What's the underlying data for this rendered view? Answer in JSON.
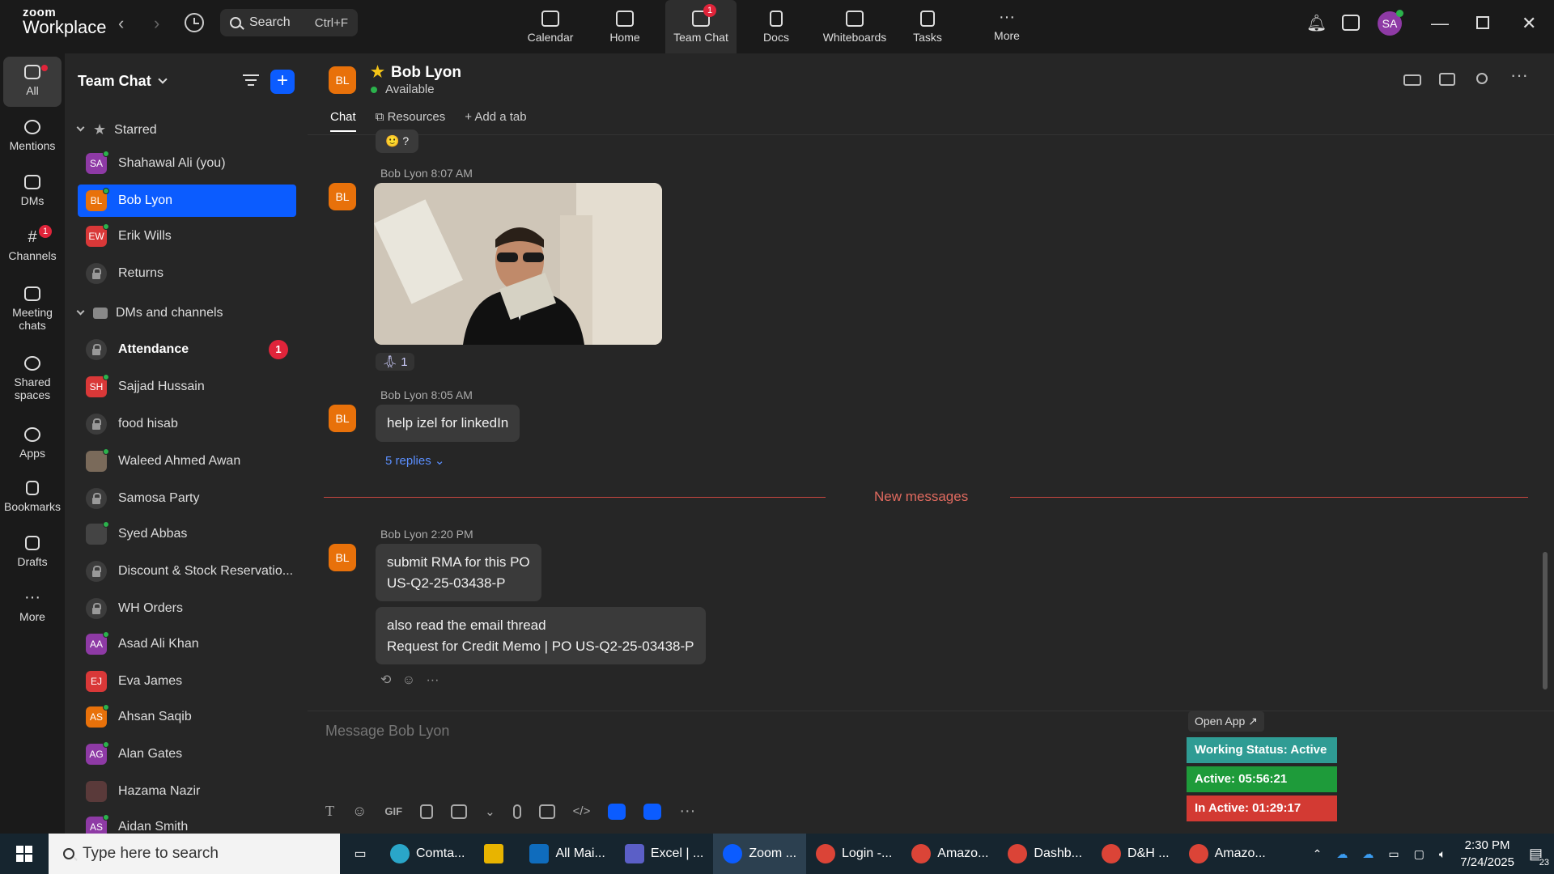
{
  "app": {
    "brand_top": "zoom",
    "brand_bottom": "Workplace"
  },
  "topbar": {
    "search_label": "Search",
    "search_shortcut": "Ctrl+F",
    "nav": [
      {
        "label": "Calendar"
      },
      {
        "label": "Home"
      },
      {
        "label": "Team Chat",
        "badge": "1"
      },
      {
        "label": "Docs"
      },
      {
        "label": "Whiteboards"
      },
      {
        "label": "Tasks"
      },
      {
        "label": "More"
      }
    ],
    "user_initials": "SA"
  },
  "rail": [
    {
      "label": "All"
    },
    {
      "label": "Mentions"
    },
    {
      "label": "DMs"
    },
    {
      "label": "Channels",
      "badge": "1"
    },
    {
      "label": "Meeting chats"
    },
    {
      "label": "Shared spaces"
    },
    {
      "label": "Apps"
    },
    {
      "label": "Bookmarks"
    },
    {
      "label": "Drafts"
    },
    {
      "label": "More"
    }
  ],
  "sidebar": {
    "title": "Team Chat",
    "section_starred": "Starred",
    "section_dms": "DMs and channels",
    "starred": [
      {
        "initials": "SA",
        "name": "Shahawal Ali (you)",
        "color": "#8e3aa5"
      },
      {
        "initials": "BL",
        "name": "Bob Lyon",
        "color": "#e8710a"
      },
      {
        "initials": "EW",
        "name": "Erik Wills",
        "color": "#d93838"
      },
      {
        "initials": "",
        "name": "Returns",
        "color": ""
      }
    ],
    "channels": [
      {
        "initials": "",
        "name": "Attendance",
        "badge": "1"
      },
      {
        "initials": "SH",
        "name": "Sajjad Hussain",
        "color": "#d93838"
      },
      {
        "initials": "",
        "name": "food hisab"
      },
      {
        "initials": "",
        "name": "Waleed Ahmed Awan",
        "color": "#7a6a5a"
      },
      {
        "initials": "",
        "name": "Samosa Party"
      },
      {
        "initials": "",
        "name": "Syed Abbas",
        "color": "#444"
      },
      {
        "initials": "",
        "name": "Discount & Stock Reservatio..."
      },
      {
        "initials": "",
        "name": "WH Orders"
      },
      {
        "initials": "AA",
        "name": "Asad Ali Khan",
        "color": "#8e3aa5"
      },
      {
        "initials": "EJ",
        "name": "Eva James",
        "color": "#d93838"
      },
      {
        "initials": "AS",
        "name": "Ahsan Saqib",
        "color": "#e8710a"
      },
      {
        "initials": "AG",
        "name": "Alan Gates",
        "color": "#8e3aa5"
      },
      {
        "initials": "",
        "name": "Hazama Nazir",
        "color": "#5a3a3a"
      },
      {
        "initials": "AS",
        "name": "Aidan Smith",
        "color": "#8e3aa5"
      }
    ]
  },
  "chat": {
    "contact_initials": "BL",
    "contact_name": "Bob Lyon",
    "contact_status": "Available",
    "tabs": [
      "Chat",
      "Resources",
      "Add a tab"
    ],
    "messages": [
      {
        "sender": "Bob Lyon",
        "time": "8:07 AM",
        "reaction_count": "1"
      },
      {
        "sender": "Bob Lyon",
        "time": "8:05 AM",
        "text": "help izel for linkedIn",
        "replies": "5 replies"
      },
      {
        "sender": "Bob Lyon",
        "time": "2:20 PM",
        "line1": "submit RMA for this PO",
        "line2": "US-Q2-25-03438-P"
      },
      {
        "line1": "also read the email thread",
        "line2": "Request for Credit Memo | PO US-Q2-25-03438-P"
      }
    ],
    "new_messages_label": "New messages",
    "composer_placeholder": "Message Bob Lyon",
    "gif_label": "GIF"
  },
  "overlay": {
    "open_app": "Open App ↗",
    "working_status": "Working Status: Active",
    "active": "Active: 05:56:21",
    "inactive": "In Active: 01:29:17",
    "colors": {
      "working": "#2f9c94",
      "active": "#1e9b3a",
      "inactive": "#d33a33"
    }
  },
  "taskbar": {
    "search_placeholder": "Type here to search",
    "apps": [
      {
        "label": "Comta...",
        "color": "#2aa6c9"
      },
      {
        "label": "",
        "color": "#e8b400"
      },
      {
        "label": "All Mai...",
        "color": "#0f6cbd"
      },
      {
        "label": "Excel | ...",
        "color": "#5b5fc7"
      },
      {
        "label": "Zoom ...",
        "color": "#0b5cff"
      },
      {
        "label": "Login -...",
        "color": "#db4437"
      },
      {
        "label": "Amazo...",
        "color": "#db4437"
      },
      {
        "label": "Dashb...",
        "color": "#db4437"
      },
      {
        "label": "D&H ...",
        "color": "#db4437"
      },
      {
        "label": "Amazo...",
        "color": "#db4437"
      }
    ],
    "time": "2:30 PM",
    "date": "7/24/2025",
    "notif_count": "23"
  }
}
